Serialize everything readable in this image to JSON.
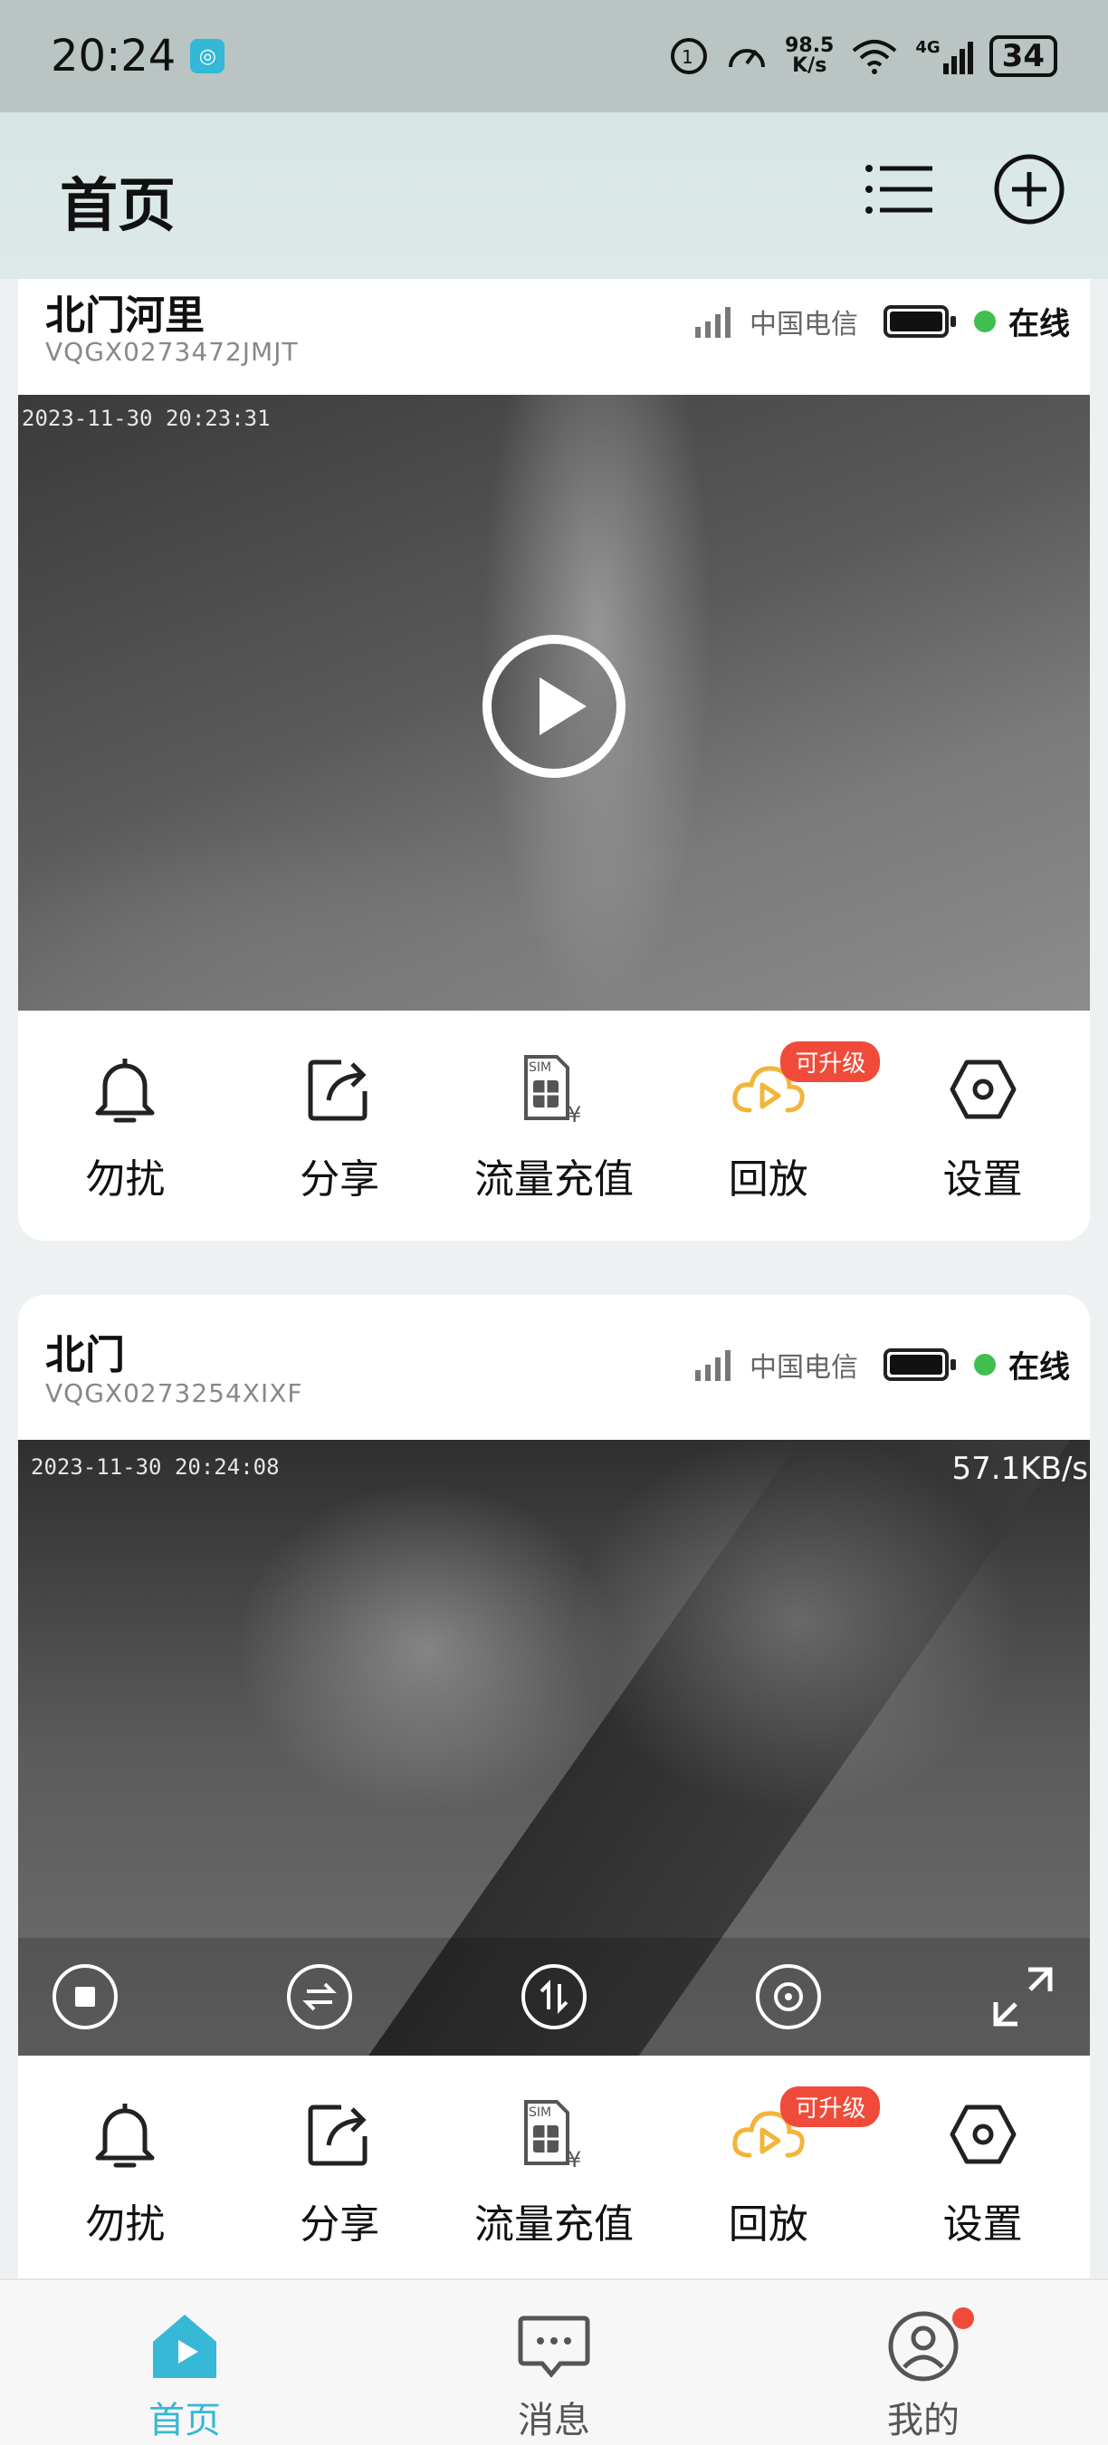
{
  "status_bar": {
    "time": "20:24",
    "app_icon": "teal-app-icon",
    "network_speed": "98.5",
    "network_unit": "K/s",
    "network_type": "4G",
    "battery": "34",
    "icons": [
      "hd-icon",
      "speed-gauge-icon",
      "wifi-icon",
      "signal-icon",
      "battery-icon"
    ]
  },
  "header": {
    "title": "首页",
    "list_icon": "list-icon",
    "add_icon": "add-circle-icon"
  },
  "devices": [
    {
      "name": "北门河里",
      "id": "VQGX0273472JMJT",
      "carrier": "中国电信",
      "status": "在线",
      "timestamp": "2023-11-30  20:23:31",
      "state": "paused"
    },
    {
      "name": "北门",
      "id": "VQGX0273254XIXF",
      "carrier": "中国电信",
      "status": "在线",
      "timestamp": "2023-11-30  20:24:08",
      "speed": "57.1KB/s",
      "state": "playing"
    }
  ],
  "actions": {
    "dnd": "勿扰",
    "share": "分享",
    "data_topup": "流量充值",
    "playback": "回放",
    "settings": "设置",
    "upgrade_badge": "可升级"
  },
  "bottom_nav": [
    {
      "label": "首页",
      "icon": "home-play-icon",
      "active": true
    },
    {
      "label": "消息",
      "icon": "message-icon",
      "active": false
    },
    {
      "label": "我的",
      "icon": "profile-icon",
      "active": false
    }
  ],
  "colors": {
    "accent": "#36b8d6",
    "online": "#3fbf4f",
    "badge": "#f04b3a",
    "playback_icon": "#f2b53a"
  }
}
